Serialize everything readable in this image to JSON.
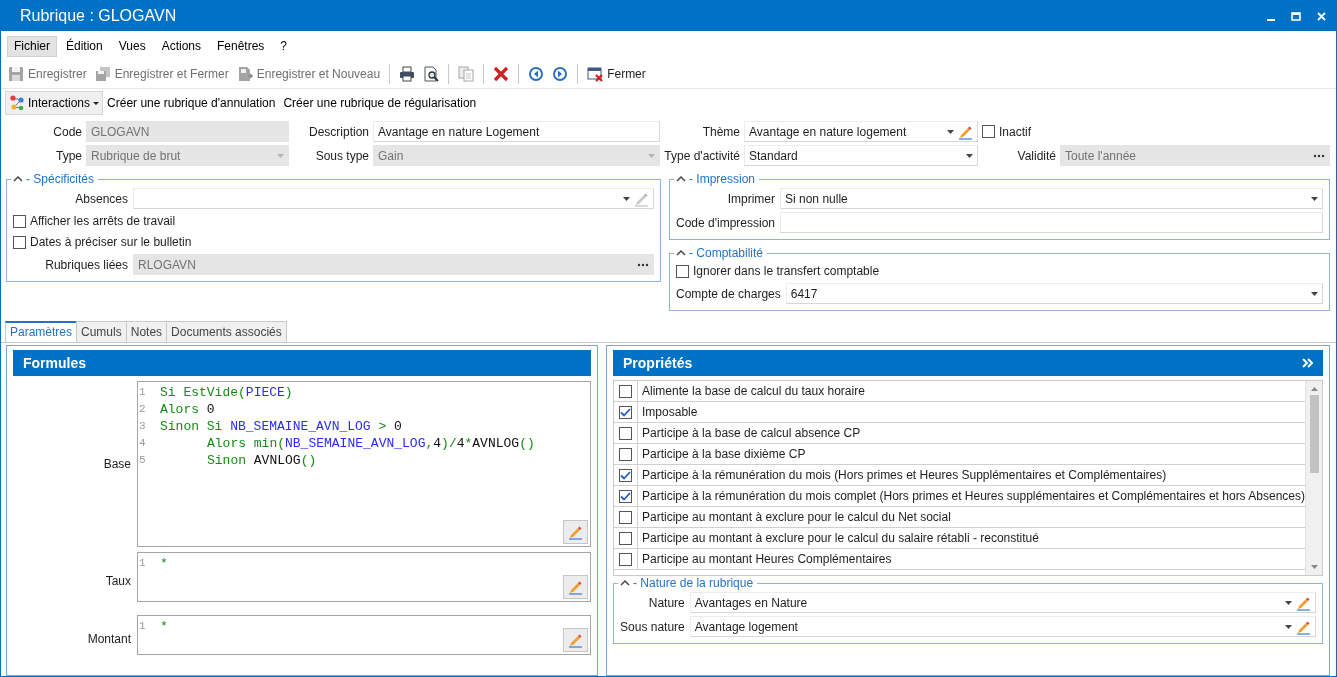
{
  "window": {
    "title": "Rubrique : GLOGAVN"
  },
  "menu": [
    {
      "label": "Fichier",
      "selected": true
    },
    {
      "label": "Édition",
      "selected": false
    },
    {
      "label": "Vues",
      "selected": false
    },
    {
      "label": "Actions",
      "selected": false
    },
    {
      "label": "Fenêtres",
      "selected": false
    },
    {
      "label": "?",
      "selected": false
    }
  ],
  "toolbar": [
    {
      "kind": "save",
      "label": "Enregistrer",
      "disabled": true
    },
    {
      "kind": "save-close",
      "label": "Enregistrer et Fermer",
      "disabled": true
    },
    {
      "kind": "save-new",
      "label": "Enregistrer et Nouveau",
      "disabled": true
    },
    {
      "kind": "separator"
    },
    {
      "kind": "print",
      "disabled": false
    },
    {
      "kind": "preview",
      "disabled": false
    },
    {
      "kind": "separator"
    },
    {
      "kind": "copy",
      "disabled": true
    },
    {
      "kind": "separator"
    },
    {
      "kind": "delete",
      "disabled": false
    },
    {
      "kind": "separator"
    },
    {
      "kind": "back",
      "disabled": false
    },
    {
      "kind": "forward",
      "disabled": false
    },
    {
      "kind": "separator"
    },
    {
      "kind": "close",
      "label": "Fermer",
      "disabled": false
    }
  ],
  "actions": [
    {
      "kind": "dropdown",
      "label": "Interactions"
    },
    {
      "kind": "link",
      "label": "Créer une rubrique d'annulation"
    },
    {
      "kind": "link",
      "label": "Créer une rubrique de régularisation"
    }
  ],
  "top_fields": [
    {
      "kind": "text",
      "label": "Code",
      "value": "GLOGAVN",
      "disabled": true
    },
    {
      "kind": "text",
      "label": "Description",
      "value": "Avantage en nature Logement",
      "disabled": false
    },
    {
      "kind": "select-edit",
      "label": "Thème",
      "value": "Avantage en nature logement",
      "disabled": false
    },
    {
      "kind": "checkbox",
      "label": "Inactif",
      "checked": false
    },
    {
      "kind": "select",
      "label": "Type",
      "value": "Rubrique de brut",
      "disabled": true
    },
    {
      "kind": "select",
      "label": "Sous type",
      "value": "Gain",
      "disabled": true
    },
    {
      "kind": "select",
      "label": "Type d'activité",
      "value": "Standard",
      "disabled": false
    },
    {
      "kind": "lookup",
      "label": "Validité",
      "value": "Toute l'année",
      "disabled": true
    }
  ],
  "groups": [
    {
      "title": "- Spécificités",
      "expanded": true,
      "fields": [
        {
          "kind": "select-edit",
          "label": "Absences",
          "disabled": false
        },
        {
          "kind": "checkbox",
          "label": "Afficher les arrêts de travail",
          "checked": false
        },
        {
          "kind": "checkbox",
          "label": "Dates à préciser sur le bulletin",
          "checked": false
        },
        {
          "kind": "lookup",
          "label": "Rubriques liées",
          "value": "RLOGAVN",
          "disabled": true
        }
      ]
    },
    {
      "title": "- Impression",
      "expanded": true,
      "fields": [
        {
          "kind": "select",
          "label": "Imprimer",
          "value": "Si non nulle",
          "disabled": false
        },
        {
          "kind": "text",
          "label": "Code d'impression",
          "disabled": false
        }
      ]
    },
    {
      "title": "- Comptabilité",
      "expanded": true,
      "fields": [
        {
          "kind": "checkbox",
          "label": "Ignorer dans le transfert comptable",
          "checked": false
        },
        {
          "kind": "select",
          "label": "Compte de charges",
          "value": "6417",
          "disabled": false
        }
      ]
    }
  ],
  "tabs": [
    {
      "label": "Paramètres",
      "selected": true
    },
    {
      "label": "Cumuls",
      "selected": false
    },
    {
      "label": "Notes",
      "selected": false
    },
    {
      "label": "Documents associés",
      "selected": false
    }
  ],
  "formulas": {
    "title": "Formules",
    "fields": [
      {
        "label": "Base",
        "lines": [
          {
            "number": "1",
            "indented": false,
            "tokens": [
              {
                "kind": "keyword",
                "text": "Si EstVide("
              },
              {
                "kind": "identifier",
                "text": "PIECE"
              },
              {
                "kind": "keyword",
                "text": ")"
              }
            ]
          },
          {
            "number": "2",
            "indented": false,
            "tokens": [
              {
                "kind": "keyword",
                "text": "Alors "
              },
              {
                "kind": "plain",
                "text": "0"
              }
            ]
          },
          {
            "number": "3",
            "indented": false,
            "tokens": [
              {
                "kind": "keyword",
                "text": "Sinon Si "
              },
              {
                "kind": "identifier",
                "text": "NB_SEMAINE_AVN_LOG"
              },
              {
                "kind": "keyword",
                "text": " > "
              },
              {
                "kind": "plain",
                "text": "0"
              }
            ]
          },
          {
            "number": "4",
            "indented": true,
            "tokens": [
              {
                "kind": "keyword",
                "text": "Alors min("
              },
              {
                "kind": "identifier",
                "text": "NB_SEMAINE_AVN_LOG"
              },
              {
                "kind": "keyword",
                "text": ","
              },
              {
                "kind": "plain",
                "text": "4"
              },
              {
                "kind": "keyword",
                "text": ")/"
              },
              {
                "kind": "plain",
                "text": "4"
              },
              {
                "kind": "keyword",
                "text": "*"
              },
              {
                "kind": "plain",
                "text": "AVNLOG"
              },
              {
                "kind": "keyword",
                "text": "()"
              }
            ]
          },
          {
            "number": "5",
            "indented": true,
            "tokens": [
              {
                "kind": "keyword",
                "text": "Sinon "
              },
              {
                "kind": "plain",
                "text": "AVNLOG"
              },
              {
                "kind": "keyword",
                "text": "()"
              }
            ]
          }
        ]
      },
      {
        "label": "Taux",
        "lines": [
          {
            "number": "1",
            "indented": false,
            "tokens": [
              {
                "kind": "keyword",
                "text": "*"
              }
            ]
          }
        ]
      },
      {
        "label": "Montant",
        "lines": [
          {
            "number": "1",
            "indented": false,
            "tokens": [
              {
                "kind": "keyword",
                "text": "*"
              }
            ]
          }
        ]
      }
    ]
  },
  "properties": {
    "title": "Propriétés",
    "rows": [
      {
        "label": "Alimente la base de calcul du taux horaire",
        "checked": false
      },
      {
        "label": "Imposable",
        "checked": true
      },
      {
        "label": "Participe à la base de calcul absence CP",
        "checked": false
      },
      {
        "label": "Participe à la base dixième CP",
        "checked": false
      },
      {
        "label": "Participe à la rémunération du mois (Hors primes et Heures Supplémentaires et Complémentaires)",
        "checked": true
      },
      {
        "label": "Participe à la rémunération du mois complet (Hors primes et Heures supplémentaires et Complémentaires et hors Absences)",
        "checked": true
      },
      {
        "label": "Participe au montant à exclure pour le calcul du Net social",
        "checked": false
      },
      {
        "label": "Participe au montant à exclure pour le calcul du salaire rétabli - reconstitué",
        "checked": false
      },
      {
        "label": "Participe au montant Heures Complémentaires",
        "checked": false
      }
    ],
    "nature": {
      "title": "- Nature de la rubrique",
      "expanded": true,
      "fields": [
        {
          "kind": "select-edit",
          "label": "Nature",
          "value": "Avantages en Nature",
          "disabled": false
        },
        {
          "kind": "select-edit",
          "label": "Sous nature",
          "value": "Avantage logement",
          "disabled": false
        }
      ]
    }
  }
}
